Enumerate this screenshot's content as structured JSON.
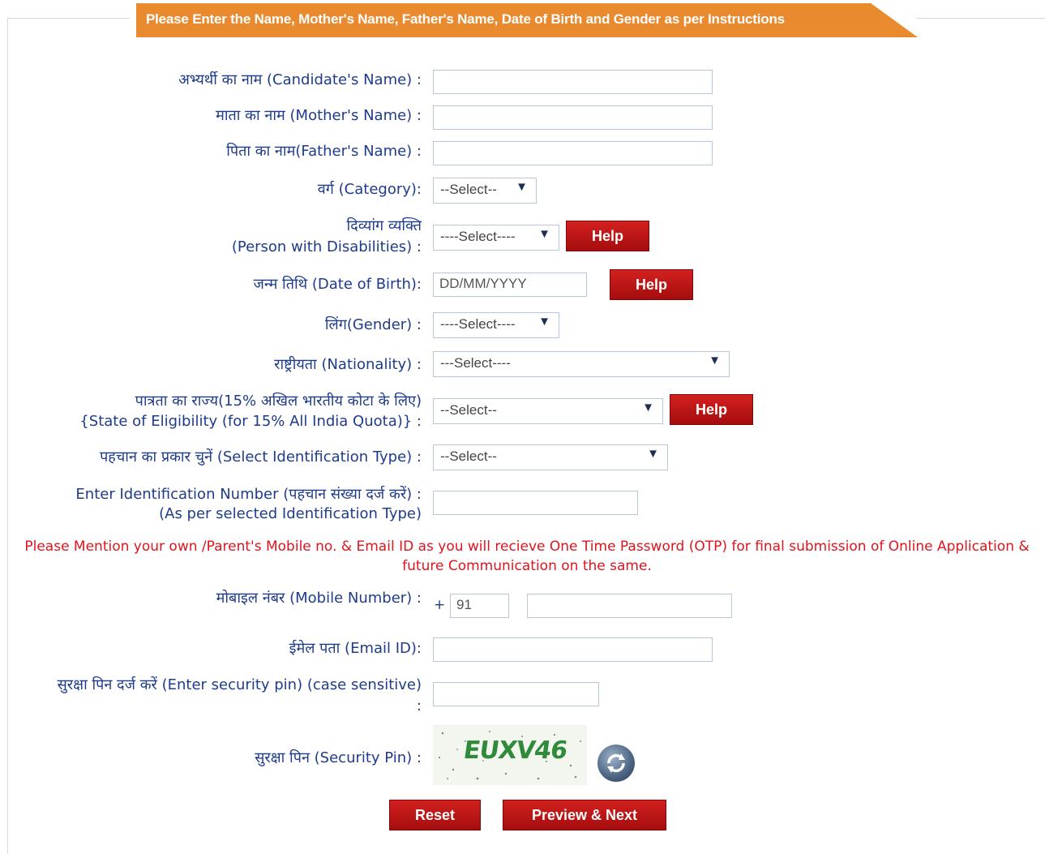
{
  "header": {
    "title": "Please Enter the Name, Mother's Name, Father's Name, Date of Birth and Gender as per Instructions"
  },
  "fields": {
    "candidate_name": {
      "label": "अभ्यर्थी का नाम (Candidate's Name) :",
      "value": ""
    },
    "mother_name": {
      "label": "माता का नाम (Mother's Name) :",
      "value": ""
    },
    "father_name": {
      "label": "पिता का नाम(Father's Name) :",
      "value": ""
    },
    "category": {
      "label": "वर्ग (Category):",
      "selected": "--Select--"
    },
    "pwd": {
      "label_line1": "दिव्यांग व्यक्ति",
      "label_line2": "(Person with Disabilities) :",
      "selected": "----Select----"
    },
    "dob": {
      "label": "जन्म तिथि (Date of Birth):",
      "placeholder": "DD/MM/YYYY"
    },
    "gender": {
      "label": "लिंग(Gender) :",
      "selected": "----Select----"
    },
    "nationality": {
      "label": "राष्ट्रीयता (Nationality) :",
      "selected": "---Select----"
    },
    "state": {
      "label_line1": "पात्रता का राज्य(15% अखिल भारतीय कोटा के लिए)",
      "label_line2": "{State of Eligibility (for 15% All India Quota)} :",
      "selected": "--Select--"
    },
    "id_type": {
      "label": "पहचान का प्रकार चुनें (Select Identification Type) :",
      "selected": "--Select--"
    },
    "id_number": {
      "label_line1": "Enter Identification Number (पहचान संख्या दर्ज करें) :",
      "label_line2": "(As per selected Identification Type)",
      "value": ""
    },
    "mobile": {
      "label": "मोबाइल नंबर (Mobile Number) :",
      "plus": "+",
      "country_code": "91",
      "value": ""
    },
    "email": {
      "label": "ईमेल पता (Email ID):",
      "value": ""
    },
    "security_pin_entry": {
      "label_line1": "सुरक्षा पिन दर्ज करें (Enter security pin) (case sensitive)",
      "label_line2": ":",
      "value": ""
    },
    "security_pin": {
      "label": "सुरक्षा पिन (Security Pin) :",
      "captcha_text": "EUXV46"
    }
  },
  "notice": "Please Mention your own /Parent's Mobile no. & Email ID as you will recieve One Time Password (OTP) for final submission of Online Application & future Communication on the same.",
  "buttons": {
    "help": "Help",
    "reset": "Reset",
    "preview_next": "Preview & Next"
  },
  "icons": {
    "dropdown": "▼",
    "refresh": "refresh-icon"
  },
  "colors": {
    "header_orange": "#ea8a2f",
    "label_blue": "#1f3c8a",
    "button_red": "#c0161a",
    "notice_red": "#e0141d"
  }
}
